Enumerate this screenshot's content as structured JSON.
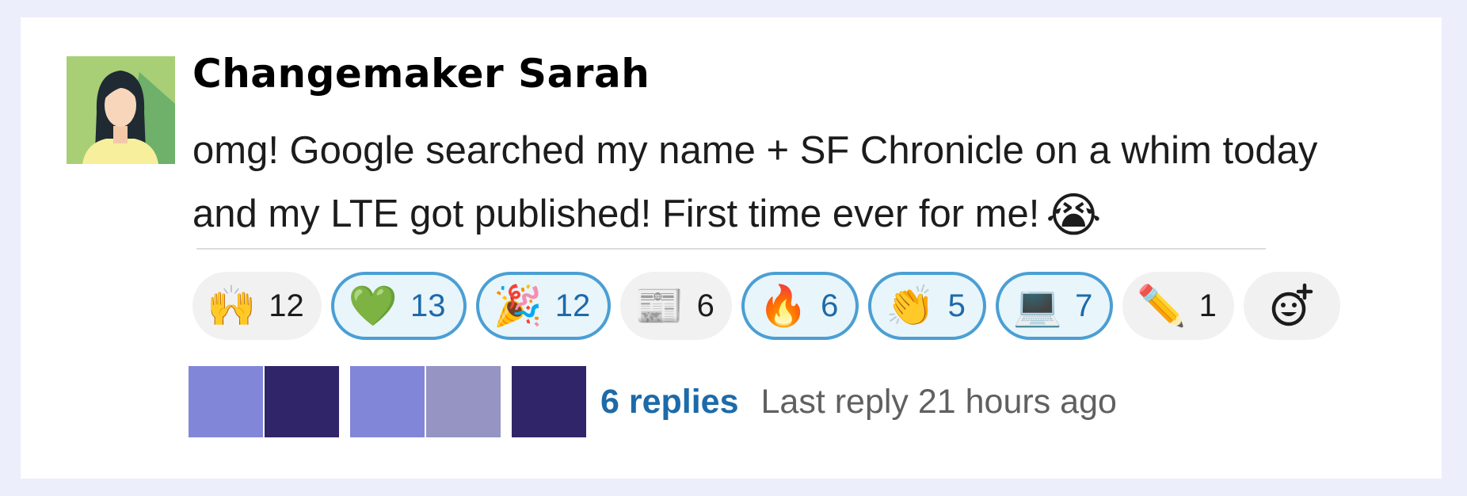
{
  "message": {
    "author": "Changemaker Sarah",
    "text": "omg! Google searched my name + SF Chronicle on a whim today and my LTE got published! First time ever for me!",
    "text_emoji": "😭"
  },
  "reactions": [
    {
      "emoji": "🙌",
      "count": "12",
      "active": false
    },
    {
      "emoji": "💚",
      "count": "13",
      "active": true
    },
    {
      "emoji": "🎉",
      "count": "12",
      "active": true
    },
    {
      "emoji": "📰",
      "count": "6",
      "active": false
    },
    {
      "emoji": "🔥",
      "count": "6",
      "active": true
    },
    {
      "emoji": "👏",
      "count": "5",
      "active": true
    },
    {
      "emoji": "💻",
      "count": "7",
      "active": true
    },
    {
      "emoji": "✏️",
      "count": "1",
      "active": false
    }
  ],
  "thread": {
    "reply_avatar_colors": [
      "#8286d8",
      "#302569",
      "#8286d8",
      "#9594c3",
      "#302569"
    ],
    "reply_count": "6 replies",
    "last_reply": "Last reply 21 hours ago"
  },
  "colors": {
    "link": "#1d6aa9",
    "active_border": "#4a9fd4",
    "background": "#eceefc"
  }
}
